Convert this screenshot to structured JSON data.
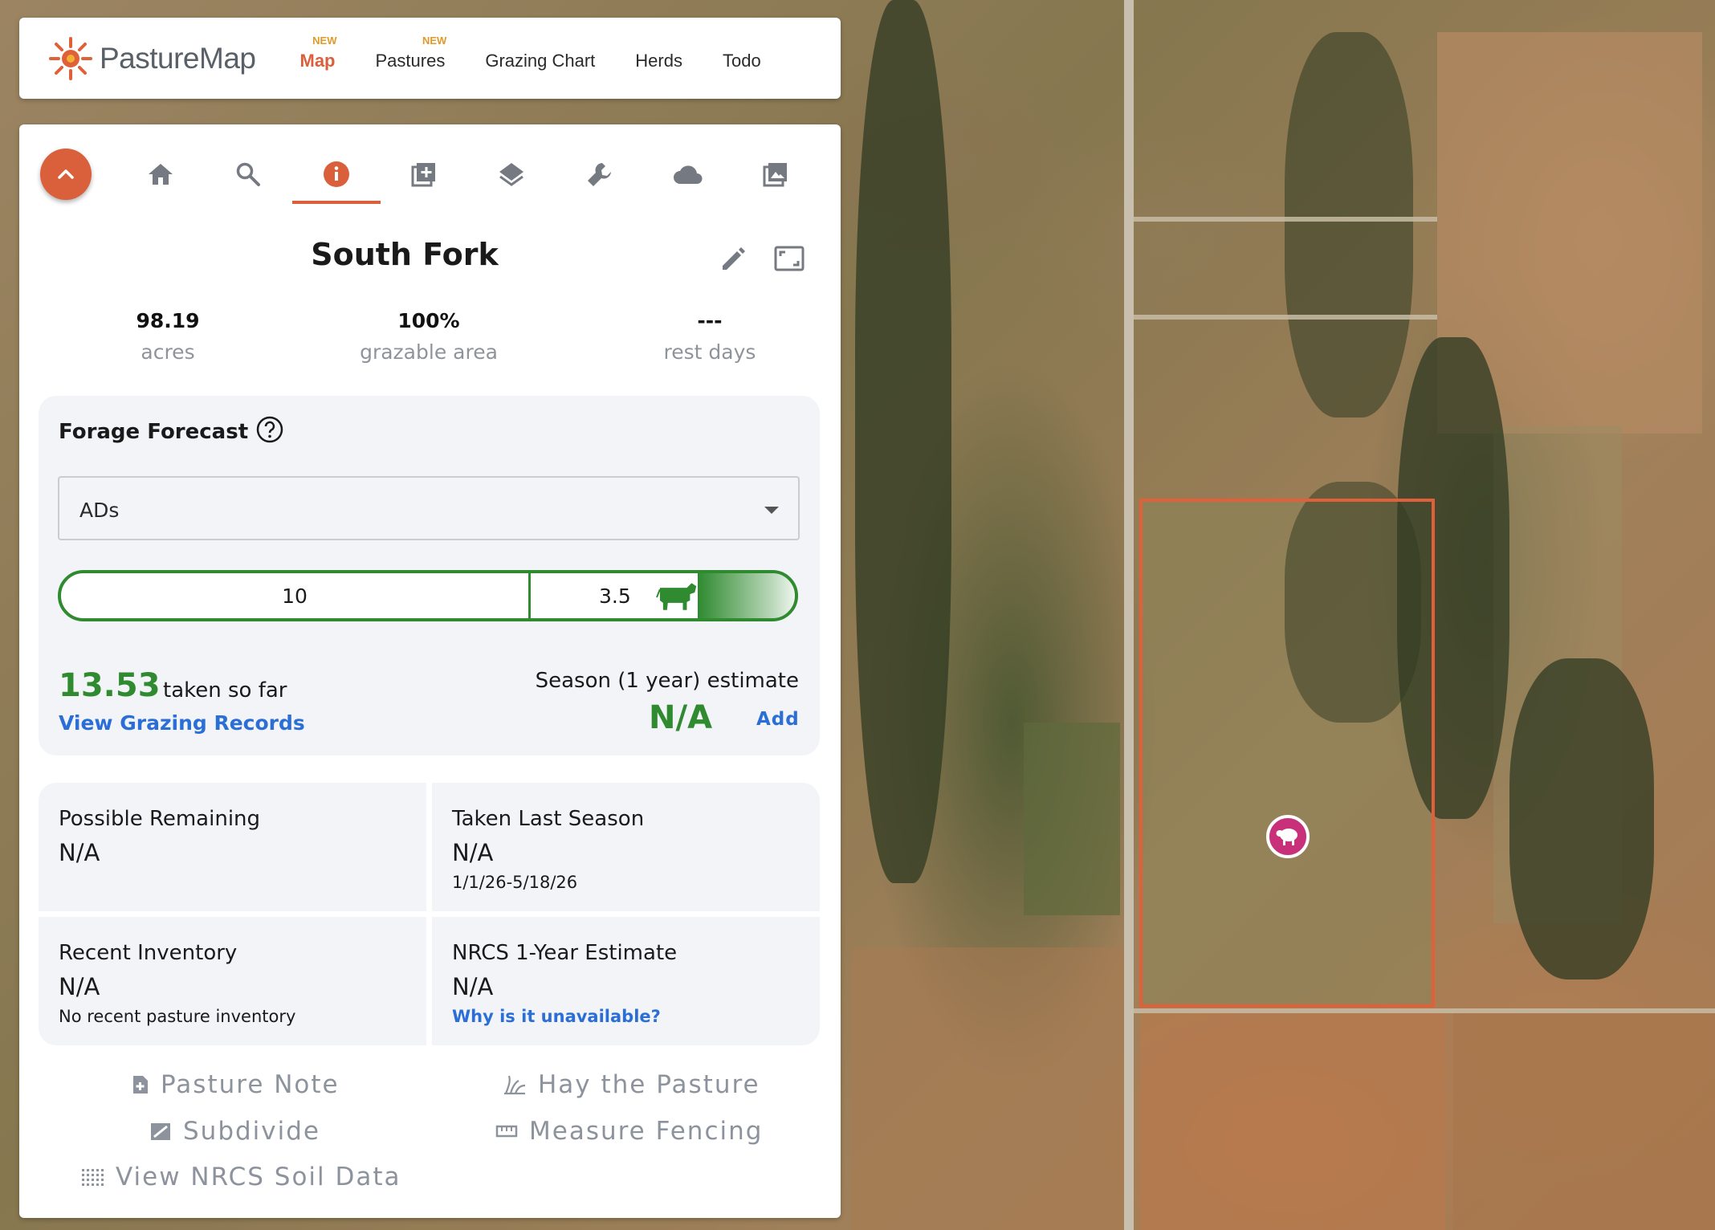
{
  "app": {
    "logo_text": "PastureMap"
  },
  "nav": {
    "items": [
      {
        "label": "Map",
        "badge": "NEW"
      },
      {
        "label": "Pastures",
        "badge": "NEW"
      },
      {
        "label": "Grazing Chart"
      },
      {
        "label": "Herds"
      },
      {
        "label": "Todo"
      }
    ],
    "active": "Map"
  },
  "toolbar": {
    "icons": [
      "home-icon",
      "search-icon",
      "info-icon",
      "add-layer-icon",
      "layers-icon",
      "wrench-icon",
      "cloud-icon",
      "image-icon"
    ],
    "active": "info-icon"
  },
  "pasture": {
    "name": "South Fork",
    "stats": [
      {
        "value": "98.19",
        "label": "acres"
      },
      {
        "value": "100%",
        "label": "grazable area"
      },
      {
        "value": "---",
        "label": "rest days"
      }
    ]
  },
  "forecast": {
    "title": "Forage Forecast",
    "unit_selected": "ADs",
    "bar_value_1": "10",
    "bar_value_2": "3.5",
    "taken_value": "13.53",
    "taken_label": "taken so far",
    "view_records": "View Grazing Records",
    "season_label": "Season (1 year) estimate",
    "season_value": "N/A",
    "season_add": "Add"
  },
  "metrics": {
    "possible_remaining": {
      "title": "Possible Remaining",
      "value": "N/A"
    },
    "taken_last_season": {
      "title": "Taken Last Season",
      "value": "N/A",
      "sub": "1/1/26-5/18/26"
    },
    "recent_inventory": {
      "title": "Recent Inventory",
      "value": "N/A",
      "sub": "No recent pasture inventory"
    },
    "nrcs_estimate": {
      "title": "NRCS 1-Year Estimate",
      "value": "N/A",
      "sub": "Why is it unavailable?"
    }
  },
  "actions": {
    "pasture_note": "Pasture Note",
    "hay_pasture": "Hay the Pasture",
    "subdivide": "Subdivide",
    "measure_fencing": "Measure Fencing",
    "nrcs_soil": "View NRCS Soil Data"
  },
  "colors": {
    "brand": "#d9603b",
    "green": "#2f8a30",
    "link": "#2b6fd6",
    "pasture_outline": "#e0603a",
    "animal_marker": "#c9307a"
  }
}
